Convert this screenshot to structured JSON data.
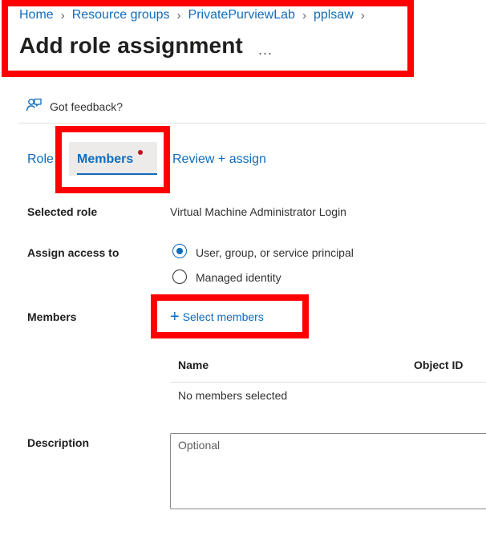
{
  "breadcrumb": [
    {
      "label": "Home"
    },
    {
      "label": "Resource groups"
    },
    {
      "label": "PrivatePurviewLab"
    },
    {
      "label": "pplsaw"
    }
  ],
  "page": {
    "title": "Add role assignment",
    "more_label": "..."
  },
  "feedback": {
    "label": "Got feedback?"
  },
  "tabs": [
    {
      "label": "Role",
      "active": false
    },
    {
      "label": "Members",
      "active": true
    },
    {
      "label": "Review + assign",
      "active": false
    }
  ],
  "form": {
    "selected_role_label": "Selected role",
    "selected_role_value": "Virtual Machine Administrator Login",
    "assign_access_label": "Assign access to",
    "assign_options": [
      {
        "label": "User, group, or service principal",
        "checked": true
      },
      {
        "label": "Managed identity",
        "checked": false
      }
    ],
    "members_label": "Members",
    "select_members_label": "Select members",
    "members_table": {
      "columns": [
        "Name",
        "Object ID"
      ],
      "empty_text": "No members selected"
    },
    "description_label": "Description",
    "description_placeholder": "Optional"
  },
  "colors": {
    "accent": "#0f6cbd",
    "highlight": "#ff0000",
    "required_dot": "#c50f1f"
  }
}
